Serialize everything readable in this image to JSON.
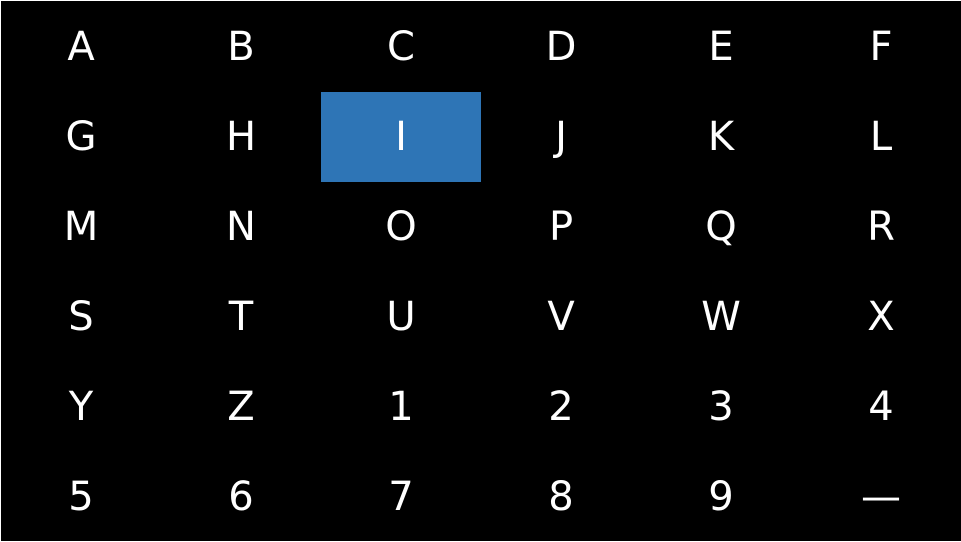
{
  "keyboard": {
    "selected_key": "I",
    "selected_color": "#2e75b6",
    "background_color": "#000000",
    "text_color": "#ffffff",
    "keys": [
      "A",
      "B",
      "C",
      "D",
      "E",
      "F",
      "G",
      "H",
      "I",
      "J",
      "K",
      "L",
      "M",
      "N",
      "O",
      "P",
      "Q",
      "R",
      "S",
      "T",
      "U",
      "V",
      "W",
      "X",
      "Y",
      "Z",
      "1",
      "2",
      "3",
      "4",
      "5",
      "6",
      "7",
      "8",
      "9",
      "—"
    ]
  }
}
